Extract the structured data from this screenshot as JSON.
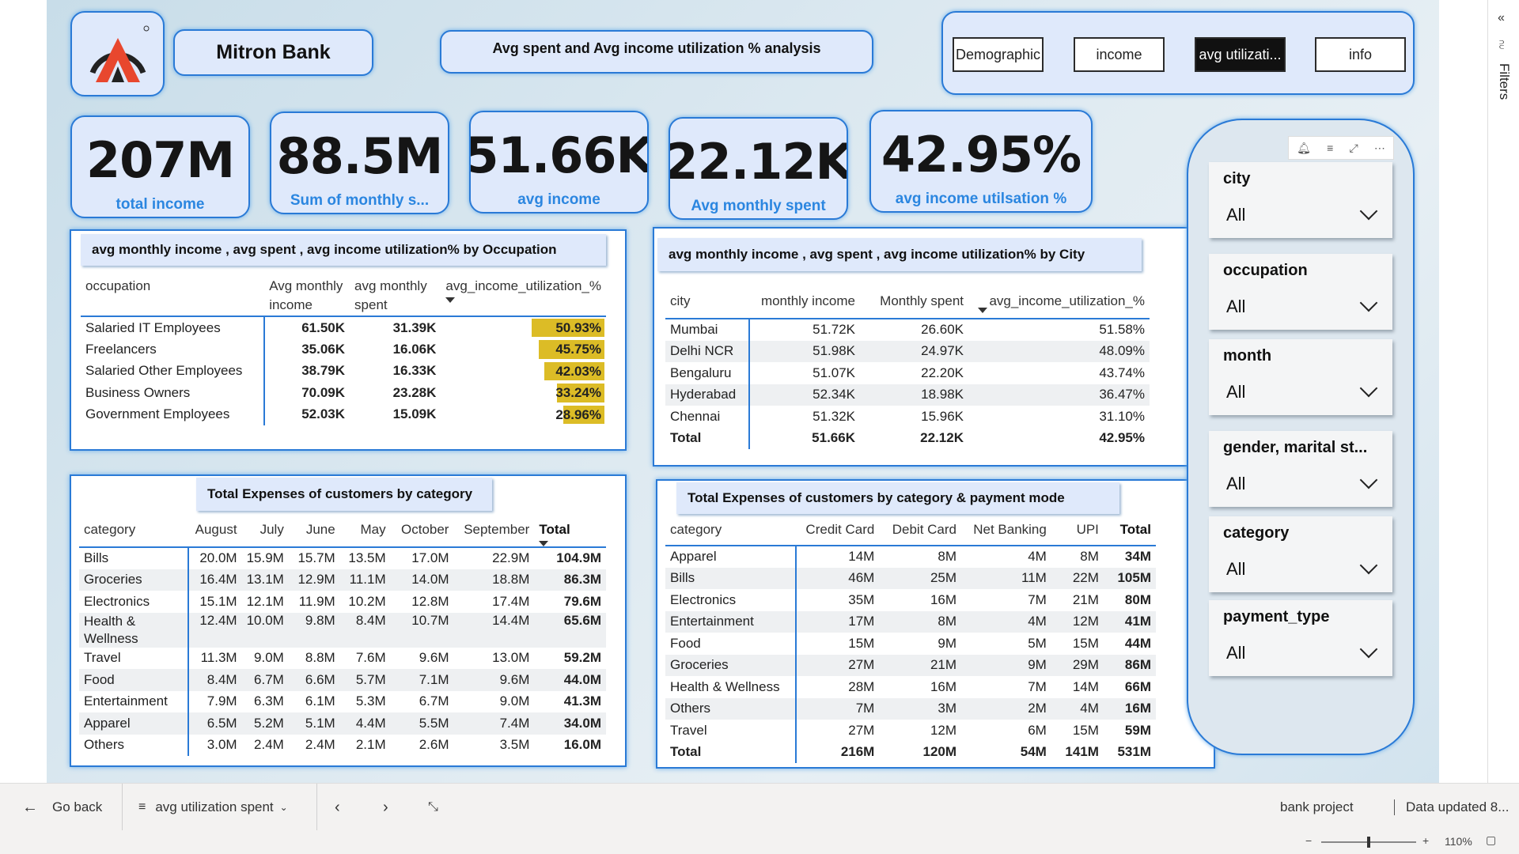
{
  "header": {
    "bank_name": "Mitron Bank",
    "page_title": "Avg spent and Avg income utilization % analysis"
  },
  "nav": {
    "buttons": [
      "Demographic",
      "income",
      "avg utilizati...",
      "info"
    ],
    "active_index": 2
  },
  "kpis": [
    {
      "value": "207M",
      "label": "total income"
    },
    {
      "value": "88.5M",
      "label": "Sum of monthly s..."
    },
    {
      "value": "51.66K",
      "label": "avg income"
    },
    {
      "value": "22.12K",
      "label": "Avg monthly spent"
    },
    {
      "value": "42.95%",
      "label": "avg income utilsation %"
    }
  ],
  "occupation_table": {
    "title": "avg monthly income , avg spent ,  avg income utilization% by Occupation",
    "headers": [
      "occupation",
      "Avg monthly income",
      "avg monthly spent",
      "avg_income_utilization_%"
    ],
    "rows": [
      {
        "occupation": "Salaried IT Employees",
        "income": "61.50K",
        "spent": "31.39K",
        "util": "50.93%",
        "util_value": 50.93
      },
      {
        "occupation": "Freelancers",
        "income": "35.06K",
        "spent": "16.06K",
        "util": "45.75%",
        "util_value": 45.75
      },
      {
        "occupation": "Salaried Other Employees",
        "income": "38.79K",
        "spent": "16.33K",
        "util": "42.03%",
        "util_value": 42.03
      },
      {
        "occupation": "Business Owners",
        "income": "70.09K",
        "spent": "23.28K",
        "util": "33.24%",
        "util_value": 33.24
      },
      {
        "occupation": "Government Employees",
        "income": "52.03K",
        "spent": "15.09K",
        "util": "28.96%",
        "util_value": 28.96
      }
    ]
  },
  "city_table": {
    "title": "avg monthly income , avg spent ,  avg income utilization% by City",
    "headers": [
      "city",
      "monthly income",
      "Monthly spent",
      "avg_income_utilization_%"
    ],
    "rows": [
      [
        "Mumbai",
        "51.72K",
        "26.60K",
        "51.58%"
      ],
      [
        "Delhi NCR",
        "51.98K",
        "24.97K",
        "48.09%"
      ],
      [
        "Bengaluru",
        "51.07K",
        "22.20K",
        "43.74%"
      ],
      [
        "Hyderabad",
        "52.34K",
        "18.98K",
        "36.47%"
      ],
      [
        "Chennai",
        "51.32K",
        "15.96K",
        "31.10%"
      ]
    ],
    "total": [
      "Total",
      "51.66K",
      "22.12K",
      "42.95%"
    ]
  },
  "category_month_table": {
    "title": "Total Expenses of customers by category",
    "headers": [
      "category",
      "August",
      "July",
      "June",
      "May",
      "October",
      "September",
      "Total"
    ],
    "rows": [
      [
        "Bills",
        "20.0M",
        "15.9M",
        "15.7M",
        "13.5M",
        "17.0M",
        "22.9M",
        "104.9M"
      ],
      [
        "Groceries",
        "16.4M",
        "13.1M",
        "12.9M",
        "11.1M",
        "14.0M",
        "18.8M",
        "86.3M"
      ],
      [
        "Electronics",
        "15.1M",
        "12.1M",
        "11.9M",
        "10.2M",
        "12.8M",
        "17.4M",
        "79.6M"
      ],
      [
        "Health & Wellness",
        "12.4M",
        "10.0M",
        "9.8M",
        "8.4M",
        "10.7M",
        "14.4M",
        "65.6M"
      ],
      [
        "Travel",
        "11.3M",
        "9.0M",
        "8.8M",
        "7.6M",
        "9.6M",
        "13.0M",
        "59.2M"
      ],
      [
        "Food",
        "8.4M",
        "6.7M",
        "6.6M",
        "5.7M",
        "7.1M",
        "9.6M",
        "44.0M"
      ],
      [
        "Entertainment",
        "7.9M",
        "6.3M",
        "6.1M",
        "5.3M",
        "6.7M",
        "9.0M",
        "41.3M"
      ],
      [
        "Apparel",
        "6.5M",
        "5.2M",
        "5.1M",
        "4.4M",
        "5.5M",
        "7.4M",
        "34.0M"
      ],
      [
        "Others",
        "3.0M",
        "2.4M",
        "2.4M",
        "2.1M",
        "2.6M",
        "3.5M",
        "16.0M"
      ]
    ]
  },
  "category_payment_table": {
    "title": "Total Expenses of customers by category & payment mode",
    "headers": [
      "category",
      "Credit Card",
      "Debit Card",
      "Net Banking",
      "UPI",
      "Total"
    ],
    "rows": [
      [
        "Apparel",
        "14M",
        "8M",
        "4M",
        "8M",
        "34M"
      ],
      [
        "Bills",
        "46M",
        "25M",
        "11M",
        "22M",
        "105M"
      ],
      [
        "Electronics",
        "35M",
        "16M",
        "7M",
        "21M",
        "80M"
      ],
      [
        "Entertainment",
        "17M",
        "8M",
        "4M",
        "12M",
        "41M"
      ],
      [
        "Food",
        "15M",
        "9M",
        "5M",
        "15M",
        "44M"
      ],
      [
        "Groceries",
        "27M",
        "21M",
        "9M",
        "29M",
        "86M"
      ],
      [
        "Health & Wellness",
        "28M",
        "16M",
        "7M",
        "14M",
        "66M"
      ],
      [
        "Others",
        "7M",
        "3M",
        "2M",
        "4M",
        "16M"
      ],
      [
        "Travel",
        "27M",
        "12M",
        "6M",
        "15M",
        "59M"
      ]
    ],
    "total": [
      "Total",
      "216M",
      "120M",
      "54M",
      "141M",
      "531M"
    ]
  },
  "slicers": [
    {
      "title": "city",
      "value": "All"
    },
    {
      "title": "occupation",
      "value": "All"
    },
    {
      "title": "month",
      "value": "All"
    },
    {
      "title": "gender, marital st...",
      "value": "All"
    },
    {
      "title": "category",
      "value": "All"
    },
    {
      "title": "payment_type",
      "value": "All"
    }
  ],
  "filters_pane": {
    "label": "Filters"
  },
  "bottom_bar": {
    "go_back": "Go back",
    "page_selector": "avg utilization spent",
    "report_name": "bank project",
    "data_updated": "Data updated 8..."
  },
  "status_bar": {
    "zoom": "110%",
    "zoom_fraction": 0.5
  },
  "colors": {
    "accent": "#2a7ad6",
    "kpi_label": "#2b86e0",
    "bar": "#dcbc26",
    "card_bg": "#dfe9fb"
  },
  "icons": [
    "logo-icon",
    "back-arrow-icon",
    "page-menu-icon",
    "chevron-left-icon",
    "chevron-right-icon",
    "collapse-icon",
    "bell-icon",
    "filter-icon",
    "focus-icon",
    "more-icon",
    "collapse-pane-icon",
    "filter-pane-icon"
  ]
}
